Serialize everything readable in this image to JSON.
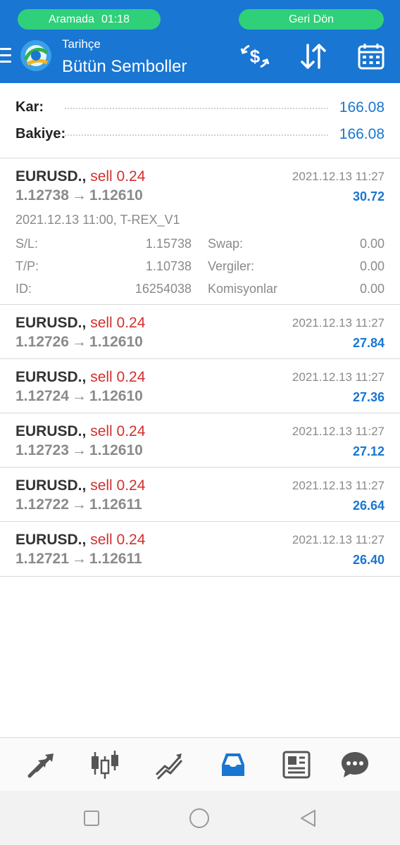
{
  "status": {
    "call_label": "Aramada",
    "call_time": "01:18",
    "back_label": "Geri Dön"
  },
  "header": {
    "subtitle": "Tarihçe",
    "title": "Bütün Semboller"
  },
  "summary": {
    "profit_label": "Kar:",
    "profit_value": "166.08",
    "balance_label": "Bakiye:",
    "balance_value": "166.08"
  },
  "trades": [
    {
      "symbol": "EURUSD.,",
      "side": "sell 0.24",
      "time": "2021.12.13 11:27",
      "open": "1.12738",
      "arrow": "→",
      "close": "1.12610",
      "profit": "30.72",
      "details": {
        "open_info": "2021.12.13 11:00, T-REX_V1",
        "sl_label": "S/L:",
        "sl_value": "1.15738",
        "tp_label": "T/P:",
        "tp_value": "1.10738",
        "id_label": "ID:",
        "id_value": "16254038",
        "swap_label": "Swap:",
        "swap_value": "0.00",
        "tax_label": "Vergiler:",
        "tax_value": "0.00",
        "commission_label": "Komisyonlar",
        "commission_value": "0.00"
      }
    },
    {
      "symbol": "EURUSD.,",
      "side": "sell 0.24",
      "time": "2021.12.13 11:27",
      "open": "1.12726",
      "arrow": "→",
      "close": "1.12610",
      "profit": "27.84"
    },
    {
      "symbol": "EURUSD.,",
      "side": "sell 0.24",
      "time": "2021.12.13 11:27",
      "open": "1.12724",
      "arrow": "→",
      "close": "1.12610",
      "profit": "27.36"
    },
    {
      "symbol": "EURUSD.,",
      "side": "sell 0.24",
      "time": "2021.12.13 11:27",
      "open": "1.12723",
      "arrow": "→",
      "close": "1.12610",
      "profit": "27.12"
    },
    {
      "symbol": "EURUSD.,",
      "side": "sell 0.24",
      "time": "2021.12.13 11:27",
      "open": "1.12722",
      "arrow": "→",
      "close": "1.12611",
      "profit": "26.64"
    },
    {
      "symbol": "EURUSD.,",
      "side": "sell 0.24",
      "time": "2021.12.13 11:27",
      "open": "1.12721",
      "arrow": "→",
      "close": "1.12611",
      "profit": "26.40"
    }
  ],
  "tabbar": {
    "items": [
      "trade-arrows-icon",
      "candlestick-chart-icon",
      "trend-lines-icon",
      "inbox-history-icon",
      "news-icon",
      "chat-icon"
    ],
    "active": "inbox-history-icon"
  },
  "colors": {
    "header_bg": "#1976d2",
    "pill_green": "#2fd07a",
    "accent_blue": "#1976d2",
    "sell_red": "#d32f2f",
    "muted_gray": "#8a8a8a"
  }
}
